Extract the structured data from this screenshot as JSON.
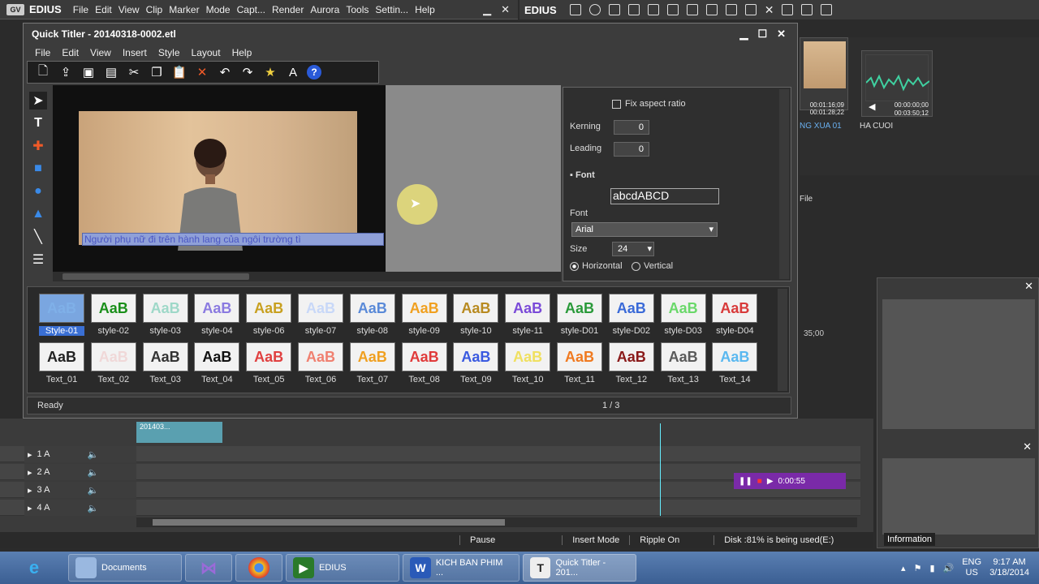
{
  "edius": {
    "logo": "EDIUS",
    "menu": [
      "File",
      "Edit",
      "View",
      "Clip",
      "Marker",
      "Mode",
      "Capt...",
      "Render",
      "Aurora",
      "Tools",
      "Settin...",
      "Help"
    ],
    "second_logo": "EDIUS"
  },
  "bin": {
    "clips": [
      {
        "name": "NG XUA 01",
        "tc1": "00:01:16;09",
        "tc2": "00:01:28;22"
      },
      {
        "name": "HA CUOI",
        "tc1": "00:00:00;00",
        "tc2": "00:03:50;12"
      }
    ],
    "side_label": "File"
  },
  "titler": {
    "title": "Quick Titler - 20140318-0002.etl",
    "menu": [
      "File",
      "Edit",
      "View",
      "Insert",
      "Style",
      "Layout",
      "Help"
    ],
    "subtitle_text": "Người phụ nữ đi trên hành lang của ngôi trường  tì",
    "props": {
      "fix_aspect": "Fix aspect ratio",
      "kerning_label": "Kerning",
      "kerning_value": "0",
      "leading_label": "Leading",
      "leading_value": "0",
      "font_section": "Font",
      "font_preview": "abcdABCD",
      "font_label": "Font",
      "font_value": "Arial",
      "size_label": "Size",
      "size_value": "24",
      "horizontal": "Horizontal",
      "vertical": "Vertical"
    },
    "styles_row1": [
      {
        "label": "Style-01",
        "color": "#7fb0e8",
        "bg": "#7aa6e0"
      },
      {
        "label": "style-02",
        "color": "#1a8f1a",
        "bg": "#f2f2f2"
      },
      {
        "label": "style-03",
        "color": "#9ed8c8",
        "bg": "#f2f2f2"
      },
      {
        "label": "style-04",
        "color": "#8a7ae0",
        "bg": "#f2f2f2"
      },
      {
        "label": "style-06",
        "color": "#c8a020",
        "bg": "#f2f2f2"
      },
      {
        "label": "style-07",
        "color": "#c8d8f8",
        "bg": "#f2f2f2"
      },
      {
        "label": "style-08",
        "color": "#5a8ad8",
        "bg": "#f2f2f2"
      },
      {
        "label": "style-09",
        "color": "#f0a020",
        "bg": "#f2f2f2"
      },
      {
        "label": "style-10",
        "color": "#b88a20",
        "bg": "#f2f2f2"
      },
      {
        "label": "style-11",
        "color": "#7a4ad8",
        "bg": "#f2f2f2"
      },
      {
        "label": "style-D01",
        "color": "#2a9a3a",
        "bg": "#f2f2f2"
      },
      {
        "label": "style-D02",
        "color": "#3a6ad8",
        "bg": "#f2f2f2"
      },
      {
        "label": "style-D03",
        "color": "#6ad86a",
        "bg": "#f2f2f2"
      },
      {
        "label": "style-D04",
        "color": "#d83a3a",
        "bg": "#f2f2f2"
      }
    ],
    "styles_row2": [
      {
        "label": "Text_01",
        "color": "#222222",
        "bg": "#f2f2f2"
      },
      {
        "label": "Text_02",
        "color": "#f0d8d8",
        "bg": "#f2f2f2"
      },
      {
        "label": "Text_03",
        "color": "#333333",
        "bg": "#f2f2f2"
      },
      {
        "label": "Text_04",
        "color": "#111111",
        "bg": "#f2f2f2"
      },
      {
        "label": "Text_05",
        "color": "#e04040",
        "bg": "#f2f2f2"
      },
      {
        "label": "Text_06",
        "color": "#f08070",
        "bg": "#f2f2f2"
      },
      {
        "label": "Text_07",
        "color": "#f0a020",
        "bg": "#f2f2f2"
      },
      {
        "label": "Text_08",
        "color": "#e03a3a",
        "bg": "#f2f2f2"
      },
      {
        "label": "Text_09",
        "color": "#3a5ae0",
        "bg": "#f2f2f2"
      },
      {
        "label": "Text_10",
        "color": "#f0e060",
        "bg": "#f2f2f2"
      },
      {
        "label": "Text_11",
        "color": "#f07a20",
        "bg": "#f2f2f2"
      },
      {
        "label": "Text_12",
        "color": "#8a1a1a",
        "bg": "#f2f2f2"
      },
      {
        "label": "Text_13",
        "color": "#5a5a5a",
        "bg": "#f2f2f2"
      },
      {
        "label": "Text_14",
        "color": "#5ab8f0",
        "bg": "#f2f2f2"
      }
    ],
    "status_left": "Ready",
    "status_page": "1 / 3"
  },
  "timeline": {
    "tracks": [
      "1 A",
      "2 A",
      "3 A",
      "4 A"
    ],
    "clip_label": "201403...",
    "recorder_time": "0:00:55",
    "time_label": "35;00"
  },
  "status": {
    "items": [
      "Pause",
      "Insert Mode",
      "Ripple On",
      "Disk :81% is being used(E:)"
    ]
  },
  "info_panel": {
    "label": "Information"
  },
  "taskbar": {
    "items": [
      "Documents",
      "",
      "",
      "EDIUS",
      "KICH BAN PHIM ...",
      "Quick Titler - 201..."
    ],
    "lang": "ENG",
    "region": "US",
    "time": "9:17 AM",
    "date": "3/18/2014"
  }
}
